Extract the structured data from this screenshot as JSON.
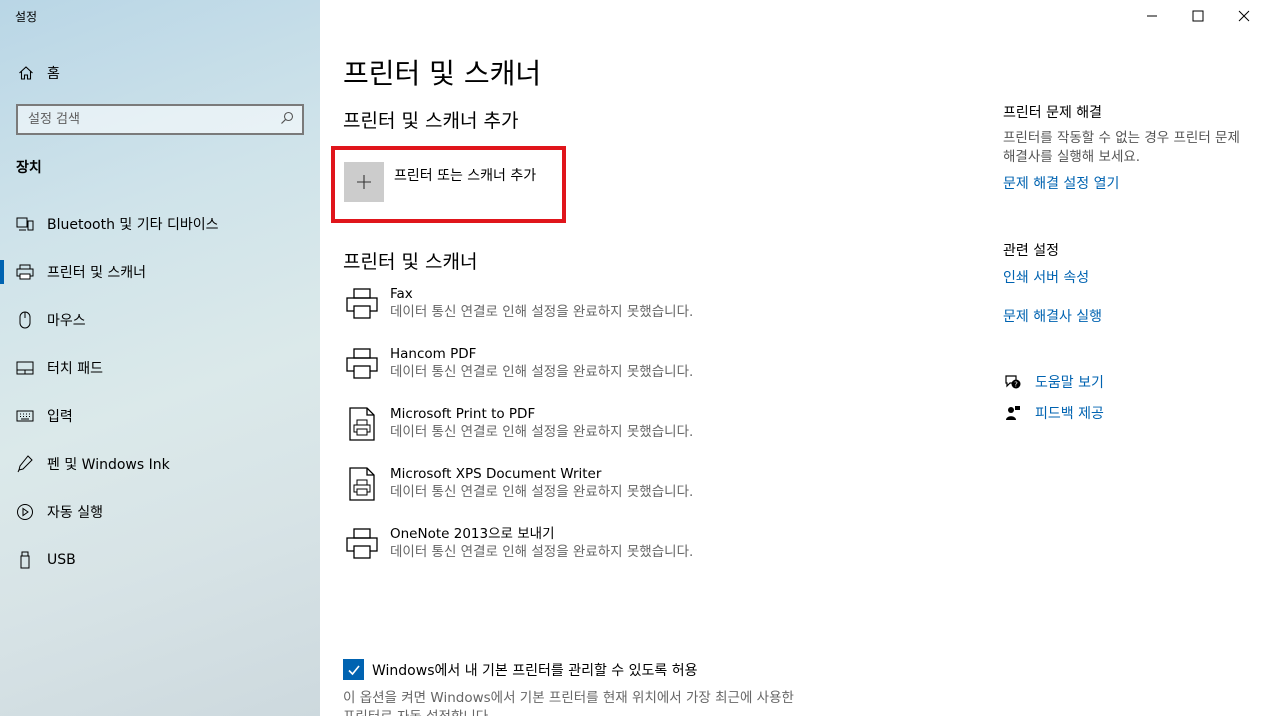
{
  "app": {
    "title": "설정"
  },
  "window_controls": {
    "minimize_icon": "minimize-icon",
    "maximize_icon": "maximize-icon",
    "close_icon": "close-icon"
  },
  "sidebar": {
    "home_label": "홈",
    "search_placeholder": "설정 검색",
    "section_title": "장치",
    "items": [
      {
        "label": "Bluetooth 및 기타 디바이스",
        "icon": "bluetooth-devices-icon",
        "active": false
      },
      {
        "label": "프린터 및 스캐너",
        "icon": "printer-icon",
        "active": true
      },
      {
        "label": "마우스",
        "icon": "mouse-icon",
        "active": false
      },
      {
        "label": "터치 패드",
        "icon": "touchpad-icon",
        "active": false
      },
      {
        "label": "입력",
        "icon": "keyboard-icon",
        "active": false
      },
      {
        "label": "펜 및 Windows Ink",
        "icon": "pen-icon",
        "active": false
      },
      {
        "label": "자동 실행",
        "icon": "autoplay-icon",
        "active": false
      },
      {
        "label": "USB",
        "icon": "usb-icon",
        "active": false
      }
    ]
  },
  "main": {
    "title": "프린터 및 스캐너",
    "add_section_title": "프린터 및 스캐너 추가",
    "add_button_label": "프린터 또는 스캐너 추가",
    "list_title": "프린터 및 스캐너",
    "printers": [
      {
        "name": "Fax",
        "status": "데이터 통신 연결로 인해 설정을 완료하지 못했습니다."
      },
      {
        "name": "Hancom PDF",
        "status": "데이터 통신 연결로 인해 설정을 완료하지 못했습니다."
      },
      {
        "name": "Microsoft Print to PDF",
        "status": "데이터 통신 연결로 인해 설정을 완료하지 못했습니다."
      },
      {
        "name": "Microsoft XPS Document Writer",
        "status": "데이터 통신 연결로 인해 설정을 완료하지 못했습니다."
      },
      {
        "name": "OneNote 2013으로 보내기",
        "status": "데이터 통신 연결로 인해 설정을 완료하지 못했습니다."
      }
    ],
    "default_printer_checkbox": {
      "label": "Windows에서 내 기본 프린터를 관리할 수 있도록 허용",
      "checked": true
    },
    "default_printer_desc": "이 옵션을 켜면 Windows에서 기본 프린터를 현재 위치에서 가장 최근에 사용한 프린터로 자동 설정합니다."
  },
  "right_panel": {
    "troubleshoot_title": "프린터 문제 해결",
    "troubleshoot_text": "프린터를 작동할 수 없는 경우 프린터 문제 해결사를 실행해 보세요.",
    "troubleshoot_link": "문제 해결 설정 열기",
    "related_title": "관련 설정",
    "related_links": [
      "인쇄 서버 속성",
      "문제 해결사 실행"
    ],
    "help_label": "도움말 보기",
    "feedback_label": "피드백 제공"
  },
  "colors": {
    "accent": "#0063b1",
    "highlight_box": "#e0151b"
  }
}
